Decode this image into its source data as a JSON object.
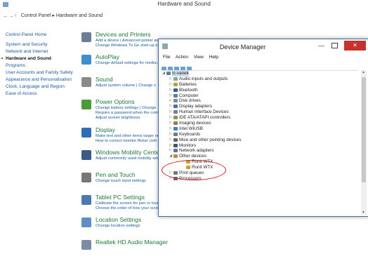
{
  "window": {
    "title": "Hardware and Sound"
  },
  "address": {
    "back": "←",
    "forward": "→",
    "up": "↑",
    "crumbs": "Control Panel ▸ Hardware and Sound"
  },
  "sidebar": {
    "items": [
      "Control Panel Home",
      "System and Security",
      "Network and Internet",
      "Hardware and Sound",
      "Programs",
      "User Accounts and Family Safety",
      "Appearance and Personalisation",
      "Clock, Language and Region",
      "Ease of Access"
    ]
  },
  "categories": [
    {
      "title": "Devices and Printers",
      "link1": "Add a device | Advanced printer setup | Mouse | Device Manager",
      "link2": "Change Windows To Go start-up op",
      "color": "#6a7d95"
    },
    {
      "title": "AutoPlay",
      "link1": "Change default settings for media o",
      "link2": "",
      "color": "#3f8fcf"
    },
    {
      "title": "Sound",
      "link1": "Adjust system volume | Change s",
      "link2": "",
      "color": "#8a8a8a"
    },
    {
      "title": "Power Options",
      "link1": "Change battery settings | Change",
      "link2": "Require a password when the comp",
      "link3": "Adjust screen brightness",
      "color": "#4a9b3a"
    },
    {
      "title": "Display",
      "link1": "Make text and other items larger or",
      "link2": "How to correct monitor flicker (refr",
      "color": "#2e6fb5"
    },
    {
      "title": "Windows Mobility Center",
      "link1": "Adjust commonly used mobility set",
      "link2": "",
      "color": "#3b5a84"
    },
    {
      "title": "Pen and Touch",
      "link1": "Change touch input settings",
      "link2": "",
      "color": "#777"
    },
    {
      "title": "Tablet PC Settings",
      "link1": "Calibrate the screen for pen or touc",
      "link2": "Choose the order of how your scree",
      "color": "#4b78b0"
    },
    {
      "title": "Location Settings",
      "link1": "Change location settings",
      "link2": "",
      "color": "#5e8fc5"
    },
    {
      "title": "Realtek HD Audio Manager",
      "link1": "",
      "link2": "",
      "color": "#7b8da6"
    }
  ],
  "device_manager": {
    "title": "Device Manager",
    "menu": [
      "File",
      "Action",
      "View",
      "Help"
    ],
    "root": "tc-vanek",
    "nodes": [
      "Audio inputs and outputs",
      "Batteries",
      "Bluetooth",
      "Computer",
      "Disk drives",
      "Display adapters",
      "Human Interface Devices",
      "IDE ATA/ATAPI controllers",
      "Imaging devices",
      "Intel WiUSB",
      "Keyboards",
      "Mice and other pointing devices",
      "Monitors",
      "Network adapters",
      "Other devices",
      "Runit WTX",
      "Runit WTX",
      "Print queues",
      "Processors"
    ]
  }
}
